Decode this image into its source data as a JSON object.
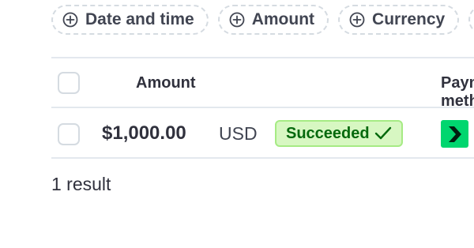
{
  "filters": [
    {
      "label": "Date and time"
    },
    {
      "label": "Amount"
    },
    {
      "label": "Currency"
    },
    {
      "label": ""
    }
  ],
  "table": {
    "headers": {
      "amount": "Amount",
      "payment_method": "Payment method"
    },
    "rows": [
      {
        "amount": "$1,000.00",
        "currency": "USD",
        "status": "Succeeded",
        "status_icon": "check-icon",
        "payment_method_icon": "link-logo-icon"
      }
    ]
  },
  "footer": {
    "result_count": "1 result"
  },
  "colors": {
    "success_bg": "#d7f7c2",
    "success_text": "#05690d",
    "brand_green": "#00d66f"
  }
}
